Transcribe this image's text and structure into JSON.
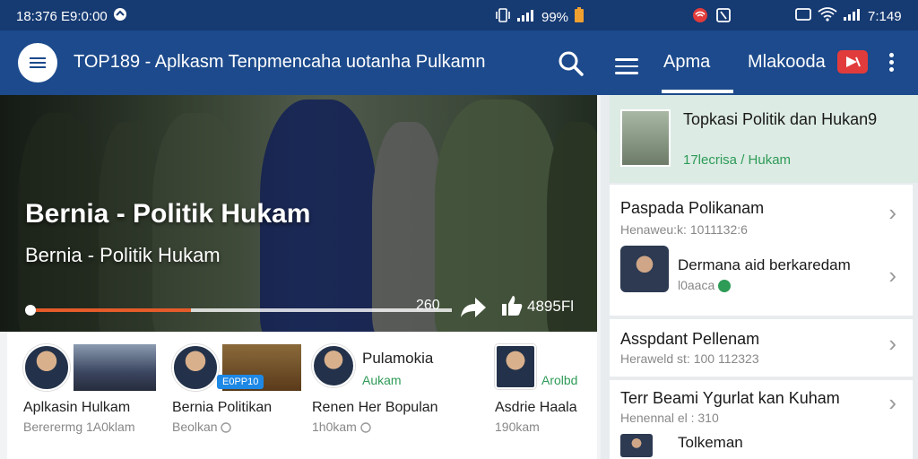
{
  "status": {
    "left_time": "18:376 E9:0:00",
    "battery": "99%",
    "right_time": "7:149"
  },
  "header": {
    "title": "TOP189 - Aplkasm Tenpmencaha uotanha Pulkamn",
    "tab_active": "Apma",
    "tab_second": "Mlakooda"
  },
  "hero": {
    "title": "Bernia - Politik Hukam",
    "subtitle": "Bernia - Politik Hukam",
    "progress": 0.38,
    "counter": "260",
    "likes": "4895Fl"
  },
  "cards": [
    {
      "title": "Aplkasin Hulkam",
      "sub": "Bererermg 1A0klam"
    },
    {
      "title": "Bernia Politikan",
      "sub": "Beolkan",
      "badge": "E0PP10"
    },
    {
      "title": "Renen Her Bopulan",
      "sub": "1h0kam",
      "name": "Pulamokia",
      "tag": "Aukam"
    },
    {
      "title": "Asdrie Haala",
      "sub": "190kam",
      "tag": "Arolbd"
    }
  ],
  "side": {
    "top_title": "Topkasi Politik dan Hukan9",
    "top_sub": "17lecrisa / Hukam",
    "rows": [
      {
        "title": "Paspada Polikanam",
        "sub": "Henaweu:k: 1011132:6"
      },
      {
        "title": "Dermana aid berkaredam",
        "sub": "l0aaca"
      },
      {
        "title": "Asspdant Pellenam",
        "sub": "Heraweld st: 100 112323"
      },
      {
        "title": "Terr Beami Ygurlat kan Kuham",
        "sub": "Henennal el : 310"
      },
      {
        "title": "Tolkeman",
        "sub": ""
      }
    ]
  },
  "colors": {
    "appbar": "#1c4a8c",
    "accent": "#e55b2a",
    "green": "#2e9b57"
  }
}
